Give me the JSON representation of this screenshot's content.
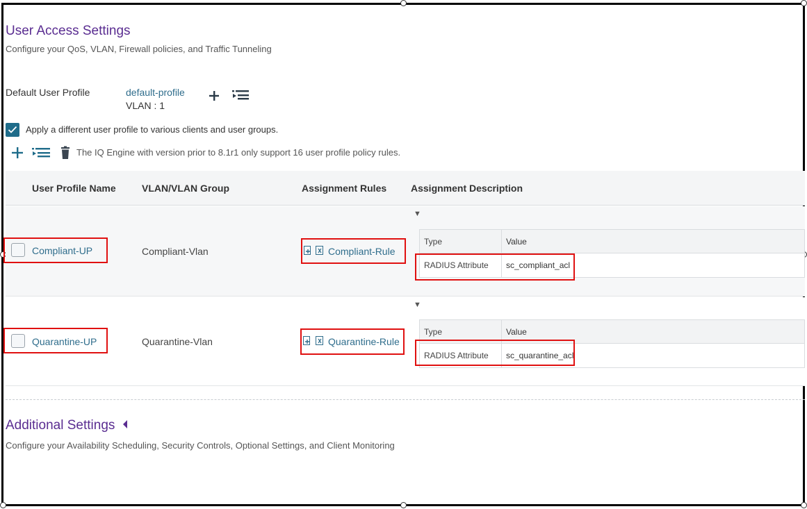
{
  "user_access": {
    "title": "User Access Settings",
    "subtitle": "Configure your QoS, VLAN, Firewall policies, and Traffic Tunneling"
  },
  "default_profile": {
    "label": "Default User Profile",
    "name": "default-profile",
    "vlan": "VLAN : 1"
  },
  "apply_checkbox": {
    "label": "Apply a different user profile to various clients and user groups.",
    "checked": true
  },
  "toolbar": {
    "notice": "The IQ Engine with version prior to 8.1r1 only support 16 user profile policy rules."
  },
  "table": {
    "headers": [
      "User Profile Name",
      "VLAN/VLAN Group",
      "Assignment Rules",
      "Assignment Description"
    ],
    "rows": [
      {
        "profile": "Compliant-UP",
        "vlan": "Compliant-Vlan",
        "rule": "Compliant-Rule",
        "desc_headers": [
          "Type",
          "Value"
        ],
        "desc_type": "RADIUS Attribute",
        "desc_value": "sc_compliant_acl"
      },
      {
        "profile": "Quarantine-UP",
        "vlan": "Quarantine-Vlan",
        "rule": "Quarantine-Rule",
        "desc_headers": [
          "Type",
          "Value"
        ],
        "desc_type": "RADIUS Attribute",
        "desc_value": "sc_quarantine_acl"
      }
    ]
  },
  "additional": {
    "title": "Additional Settings",
    "subtitle": "Configure your Availability Scheduling, Security Controls, Optional Settings, and Client Monitoring"
  },
  "colors": {
    "title_purple": "#5a2d91",
    "link_blue": "#2f6d8c",
    "checkbox_teal": "#1f6c8a",
    "highlight_red": "#e01010"
  },
  "icons": [
    "plus-icon",
    "list-assign-icon",
    "trash-icon",
    "caret-down-icon",
    "caret-left-icon",
    "add-rule-icon",
    "remove-rule-icon",
    "checkmark-icon"
  ]
}
